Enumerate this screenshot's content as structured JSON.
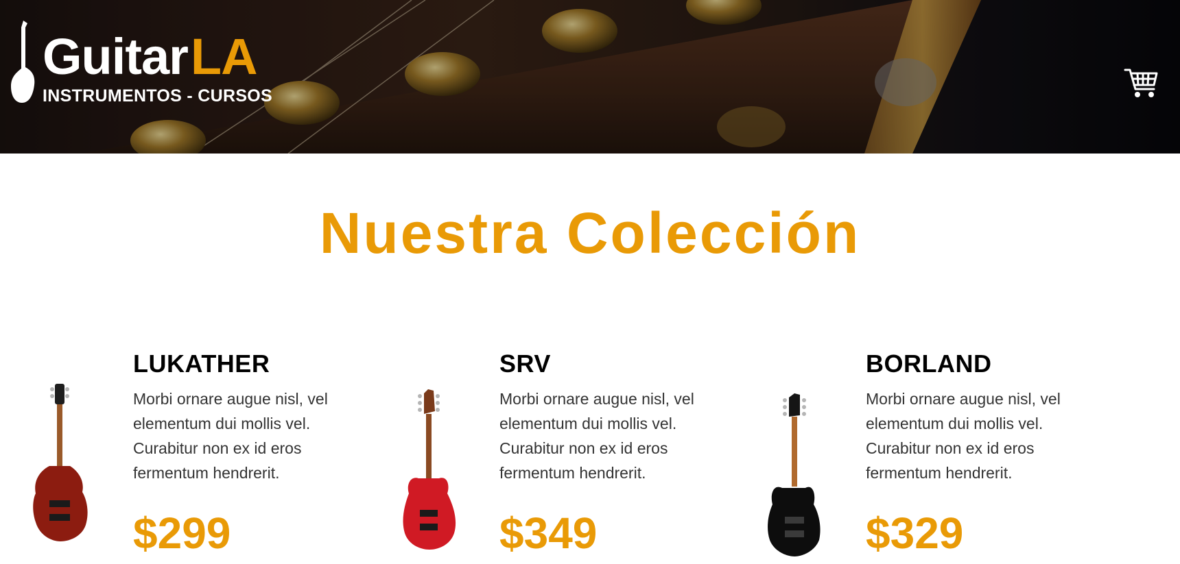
{
  "header": {
    "logo": {
      "title_main": "Guitar",
      "title_accent": "LA",
      "subtitle": "INSTRUMENTOS - CURSOS"
    },
    "cart_icon": "shopping-cart-icon"
  },
  "main": {
    "title": "Nuestra Colección",
    "products": [
      {
        "name": "LUKATHER",
        "description": "Morbi ornare augue nisl, vel elementum dui mollis vel. Curabitur non ex id eros fermentum hendrerit.",
        "price": "$299",
        "body_color": "#8c1c10"
      },
      {
        "name": "SRV",
        "description": "Morbi ornare augue nisl, vel elementum dui mollis vel. Curabitur non ex id eros fermentum hendrerit.",
        "price": "$349",
        "body_color": "#d01a24"
      },
      {
        "name": "BORLAND",
        "description": "Morbi ornare augue nisl, vel elementum dui mollis vel. Curabitur non ex id eros fermentum hendrerit.",
        "price": "$329",
        "body_color": "#0d0d0d"
      }
    ]
  },
  "colors": {
    "accent": "#e99a06",
    "heading": "#000000",
    "text": "#333333",
    "header_bg": "#1b1210"
  }
}
